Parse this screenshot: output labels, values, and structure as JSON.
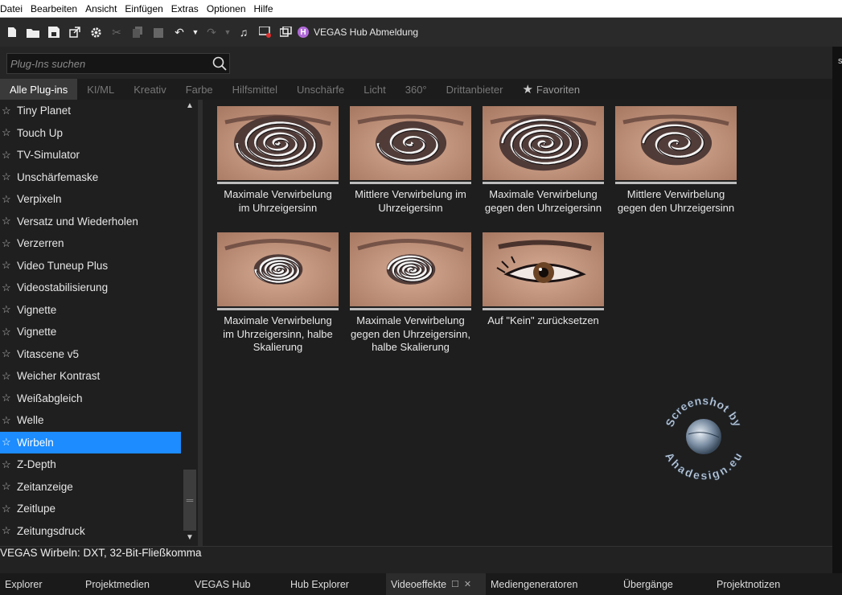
{
  "menu": [
    "Datei",
    "Bearbeiten",
    "Ansicht",
    "Einfügen",
    "Extras",
    "Optionen",
    "Hilfe"
  ],
  "toolbar": {
    "hub_label": "VEGAS Hub Abmeldung",
    "hub_badge": "H"
  },
  "search": {
    "placeholder": "Plug-Ins suchen"
  },
  "tabs": [
    "Alle Plug-ins",
    "KI/ML",
    "Kreativ",
    "Farbe",
    "Hilfsmittel",
    "Unschärfe",
    "Licht",
    "360°",
    "Drittanbieter"
  ],
  "favorites_label": "Favoriten",
  "plugins": [
    "Tiny Planet",
    "Touch Up",
    "TV-Simulator",
    "Unschärfemaske",
    "Verpixeln",
    "Versatz und Wiederholen",
    "Verzerren",
    "Video Tuneup Plus",
    "Videostabilisierung",
    "Vignette",
    "Vignette",
    "Vitascene v5",
    "Weicher Kontrast",
    "Weißabgleich",
    "Welle",
    "Wirbeln",
    "Z-Depth",
    "Zeitanzeige",
    "Zeitlupe",
    "Zeitungsdruck"
  ],
  "selected_plugin": "Wirbeln",
  "presets": [
    {
      "label": "Maximale Verwirbelung im Uhrzeigersinn"
    },
    {
      "label": "Mittlere Verwirbelung im Uhrzeigersinn"
    },
    {
      "label": "Maximale Verwirbelung gegen den Uhrzeigersinn"
    },
    {
      "label": "Mittlere Verwirbelung gegen den Uhrzeigersinn"
    },
    {
      "label": "Maximale Verwirbelung im Uhrzeigersinn, halbe Skalierung"
    },
    {
      "label": "Maximale Verwirbelung gegen den Uhrzeigersinn, halbe Skalierung"
    },
    {
      "label": "Auf \"Kein\" zurücksetzen"
    }
  ],
  "watermark": {
    "top": "Screenshot by",
    "bottom": "Ahadesign.eu"
  },
  "status": "VEGAS Wirbeln: DXT, 32-Bit-Fließkomma",
  "bottom_tabs": [
    "Explorer",
    "Projektmedien",
    "VEGAS Hub",
    "Hub Explorer",
    "Videoeffekte",
    "Mediengeneratoren",
    "Übergänge",
    "Projektnotizen"
  ],
  "active_bottom_tab": "Videoeffekte",
  "colors": {
    "selection": "#1c8cff",
    "background": "#1e1e1e",
    "hub_badge": "#b06ad8"
  }
}
